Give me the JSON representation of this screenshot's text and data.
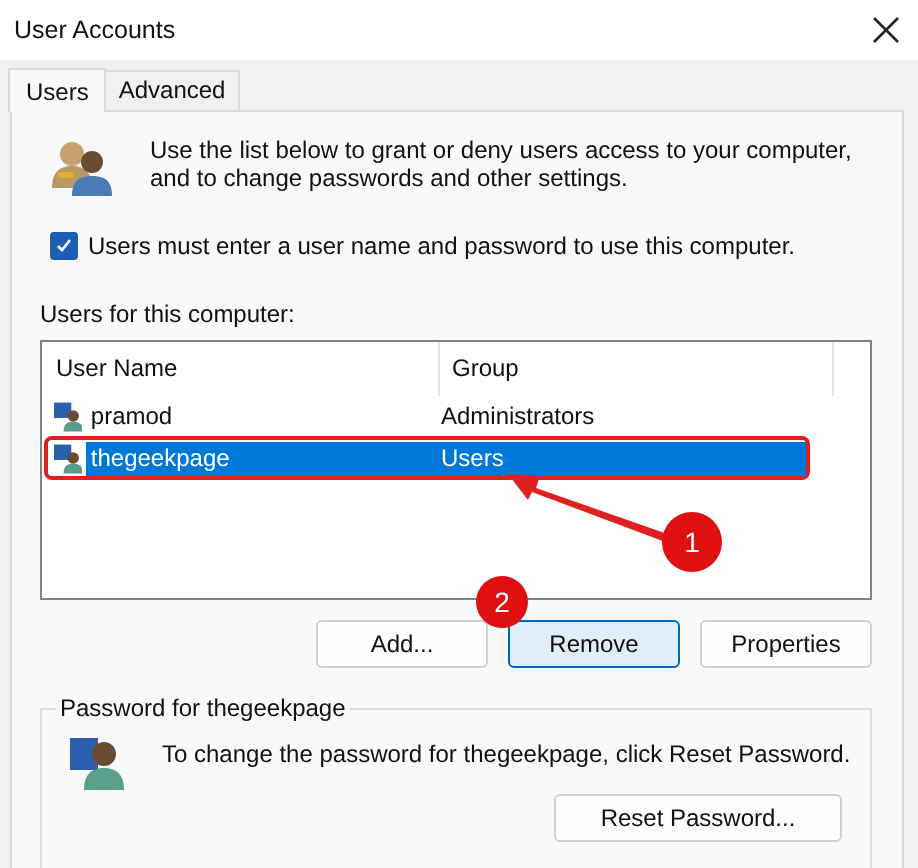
{
  "window": {
    "title": "User Accounts"
  },
  "tabs": [
    {
      "label": "Users",
      "selected": true
    },
    {
      "label": "Advanced",
      "selected": false
    }
  ],
  "intro": "Use the list below to grant or deny users access to your computer, and to change passwords and other settings.",
  "require_login": {
    "label": "Users must enter a user name and password to use this computer.",
    "checked": true
  },
  "users_label": "Users for this computer:",
  "table": {
    "columns": [
      "User Name",
      "Group"
    ],
    "rows": [
      {
        "name": "pramod",
        "group": "Administrators",
        "selected": false,
        "highlighted": false
      },
      {
        "name": "thegeekpage",
        "group": "Users",
        "selected": true,
        "highlighted": true
      }
    ]
  },
  "buttons": [
    {
      "label": "Add...",
      "focused": false
    },
    {
      "label": "Remove",
      "focused": true
    },
    {
      "label": "Properties",
      "focused": false
    }
  ],
  "password_group": {
    "title": "Password for thegeekpage",
    "text": "To change the password for thegeekpage, click Reset Password.",
    "button": "Reset Password..."
  },
  "callouts": [
    {
      "number": "1"
    },
    {
      "number": "2"
    }
  ]
}
